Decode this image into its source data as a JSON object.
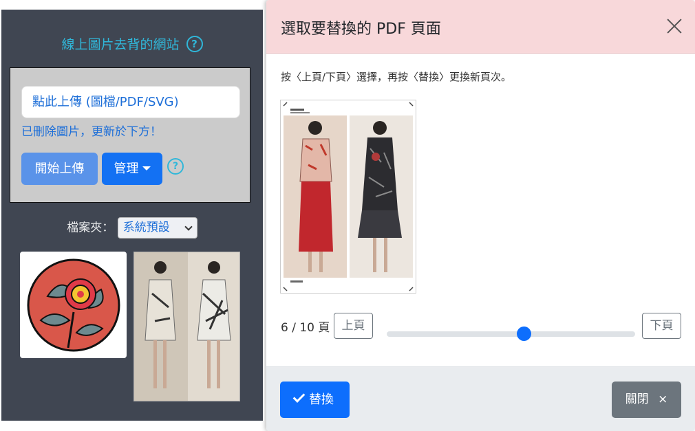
{
  "site": {
    "title": "線上圖片去背的網站",
    "help_glyph": "?"
  },
  "upload": {
    "input_label": "點此上傳 (圖檔/PDF/SVG)",
    "deleted_note": "已刪除圖片，更新於下方！",
    "start_button": "開始上傳",
    "manage_button": "管理",
    "help_glyph": "?"
  },
  "folder": {
    "label": "檔案夾：",
    "selected": "系統預設"
  },
  "modal": {
    "title": "選取要替換的 PDF 頁面",
    "instruction": "按〈上頁/下頁〉選擇，再按〈替換〉更換新頁次。",
    "page_counter": "6 / 10 頁",
    "prev_button": "上頁",
    "next_button": "下頁",
    "page_slider": {
      "current": 6,
      "total": 10
    },
    "replace_button": "替換",
    "close_button": "關閉",
    "close_glyph": "×"
  },
  "colors": {
    "accent_cyan": "#30b7d9",
    "primary_blue": "#0d6efd",
    "header_pink": "#f8d8da",
    "panel_dark": "#404652"
  }
}
